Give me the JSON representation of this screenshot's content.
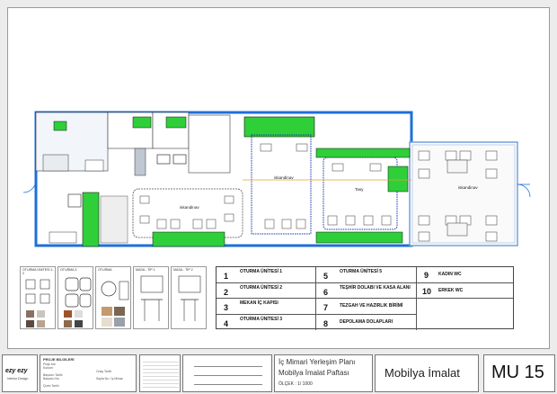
{
  "plan": {
    "zones": [
      {
        "name": "iskandinav"
      },
      {
        "name": "iskandinav"
      },
      {
        "name": "Tasy"
      },
      {
        "name": "iskandinav"
      }
    ]
  },
  "legend": {
    "items": [
      {
        "num": "1",
        "label": "OTURMA ÜNİTESİ 1"
      },
      {
        "num": "2",
        "label": "OTURMA ÜNİTESİ 2"
      },
      {
        "num": "3",
        "label": "MEKAN İÇ KAPISI"
      },
      {
        "num": "4",
        "label": "OTURMA ÜNİTESİ 3"
      },
      {
        "num": "5",
        "label": "OTURMA ÜNİTESİ 5"
      },
      {
        "num": "6",
        "label": "TEŞHİR DOLABI VE KASA ALANI"
      },
      {
        "num": "7",
        "label": "TEZGAH VE HAZIRLIK BİRİMİ"
      },
      {
        "num": "8",
        "label": "DEPOLAMA DOLAPLARI"
      },
      {
        "num": "9",
        "label": "KADIN WC"
      },
      {
        "num": "10",
        "label": "ERKEK WC"
      }
    ]
  },
  "furniture_panels": [
    {
      "title": "OTURMA ÜNİTESİ 1-2"
    },
    {
      "title": "OTURMA 3"
    },
    {
      "title": "OTURMA"
    },
    {
      "title": "MASA - TİP 1"
    },
    {
      "title": "MASA - TİP 2"
    }
  ],
  "titleblock": {
    "logo": "ezy ezy",
    "logo_sub": "Interior Design",
    "project_heading": "PROJE BİLGİLERİ",
    "project_lines": [
      "Proje Adı",
      "Konum",
      "",
      "Başvuru Tarihi",
      "Başvuru No",
      "",
      "Çizim Tarihi"
    ],
    "project_right": [
      "Onay Tarihi",
      "",
      "Sayfa No / İç Mimar",
      "",
      ""
    ],
    "title_line1": "İç Mimari Yerleşim Planı",
    "title_line2": "Mobilya İmalat Paftası",
    "scale": "ÖLÇEK : 1/ 1000",
    "sheet_name": "Mobilya İmalat",
    "sheet_code": "MU 15"
  }
}
